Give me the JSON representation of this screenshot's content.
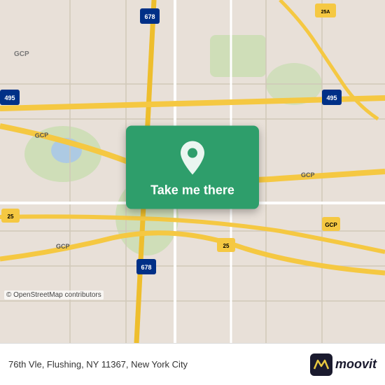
{
  "map": {
    "attribution": "© OpenStreetMap contributors",
    "bg_color": "#e8e0d8",
    "road_color_highway": "#f5c842",
    "road_color_major": "#ffffff",
    "road_color_minor": "#d0c8b8",
    "park_color": "#c8ddb0",
    "water_color": "#a8c8e8"
  },
  "card": {
    "button_label": "Take me there",
    "bg_color": "#2e9e6b"
  },
  "footer": {
    "address": "76th Vle, Flushing, NY 11367, New York City",
    "logo_text": "moovit"
  }
}
